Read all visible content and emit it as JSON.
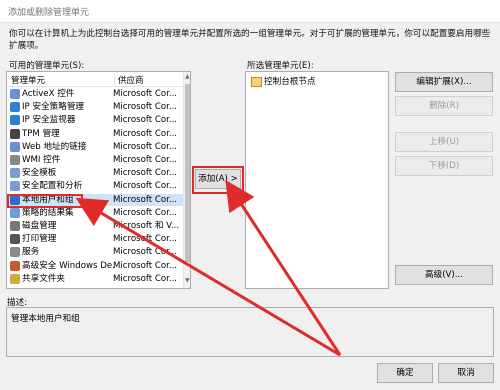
{
  "window": {
    "title": "添加或删除管理单元"
  },
  "intro": "你可以在计算机上为此控制台选择可用的管理单元并配置所选的一组管理单元。对于可扩展的管理单元，你可以配置要启用哪些扩展项。",
  "available": {
    "label": "可用的管理单元(S):",
    "col_name": "管理单元",
    "col_vendor": "供应商",
    "items": [
      {
        "name": "ActiveX 控件",
        "vendor": "Microsoft Cor...",
        "icon": "activex-icon"
      },
      {
        "name": "IP 安全策略管理",
        "vendor": "Microsoft Cor...",
        "icon": "ip-policy-icon"
      },
      {
        "name": "IP 安全监视器",
        "vendor": "Microsoft Cor...",
        "icon": "ip-monitor-icon"
      },
      {
        "name": "TPM 管理",
        "vendor": "Microsoft Cor...",
        "icon": "tpm-icon"
      },
      {
        "name": "Web 地址的链接",
        "vendor": "Microsoft Cor...",
        "icon": "web-link-icon"
      },
      {
        "name": "WMI 控件",
        "vendor": "Microsoft Cor...",
        "icon": "wmi-icon"
      },
      {
        "name": "安全模板",
        "vendor": "Microsoft Cor...",
        "icon": "security-template-icon"
      },
      {
        "name": "安全配置和分析",
        "vendor": "Microsoft Cor...",
        "icon": "security-config-icon"
      },
      {
        "name": "本地用户和组",
        "vendor": "Microsoft Cor...",
        "icon": "local-users-icon"
      },
      {
        "name": "策略的结果集",
        "vendor": "Microsoft Cor...",
        "icon": "rsop-icon"
      },
      {
        "name": "磁盘管理",
        "vendor": "Microsoft 和 V...",
        "icon": "disk-icon"
      },
      {
        "name": "打印管理",
        "vendor": "Microsoft Cor...",
        "icon": "print-icon"
      },
      {
        "name": "服务",
        "vendor": "Microsoft Cor...",
        "icon": "services-icon"
      },
      {
        "name": "高级安全 Windows De...",
        "vendor": "Microsoft Cor...",
        "icon": "firewall-icon"
      },
      {
        "name": "共享文件夹",
        "vendor": "Microsoft Cor...",
        "icon": "shared-folder-icon"
      }
    ]
  },
  "add_button": "添加(A) >",
  "selected": {
    "label": "所选管理单元(E):",
    "root": "控制台根节点"
  },
  "buttons": {
    "edit_ext": "编辑扩展(X)...",
    "remove": "删除(R)",
    "up": "上移(U)",
    "down": "下移(D)",
    "advanced": "高级(V)...",
    "ok": "确定",
    "cancel": "取消"
  },
  "description": {
    "label": "描述:",
    "text": "管理本地用户和组"
  },
  "colors": {
    "highlight": "#e12a2a",
    "selection": "#cfe3f7"
  }
}
